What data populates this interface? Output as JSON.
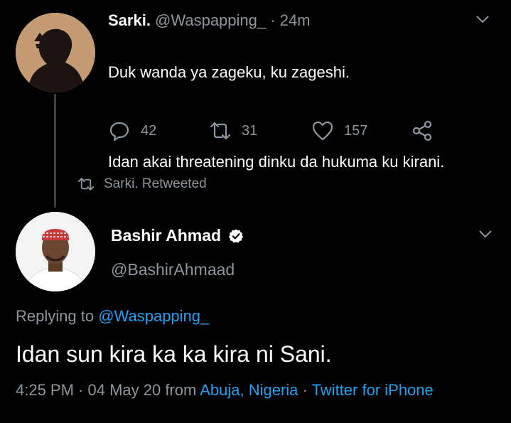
{
  "tweet1": {
    "name": "Sarki.",
    "handle": "@Waspapping_",
    "time": "24m",
    "separator": "·",
    "line1": "Duk wanda ya zageku, ku zageshi.",
    "line2": "Idan akai threatening dinku da hukuma ku kirani.",
    "replies": "42",
    "retweets": "31",
    "likes": "157"
  },
  "retweet_notice": "Sarki. Retweeted",
  "tweet2": {
    "name": "Bashir Ahmad",
    "handle": "@BashirAhmaad",
    "replying_prefix": "Replying to",
    "replying_handle": "@Waspapping_",
    "text": "Idan sun kira ka ka kira ni Sani.",
    "time": "4:25 PM · 04 May 20 from",
    "location": "Abuja, Nigeria",
    "dot": " · ",
    "source": "Twitter for iPhone"
  },
  "colors": {
    "link": "#1da1f2",
    "muted": "#8e979f",
    "background": "#000000"
  },
  "icons": [
    "reply-icon",
    "retweet-icon",
    "like-icon",
    "share-icon",
    "chevron-down-icon",
    "verified-badge-icon"
  ]
}
